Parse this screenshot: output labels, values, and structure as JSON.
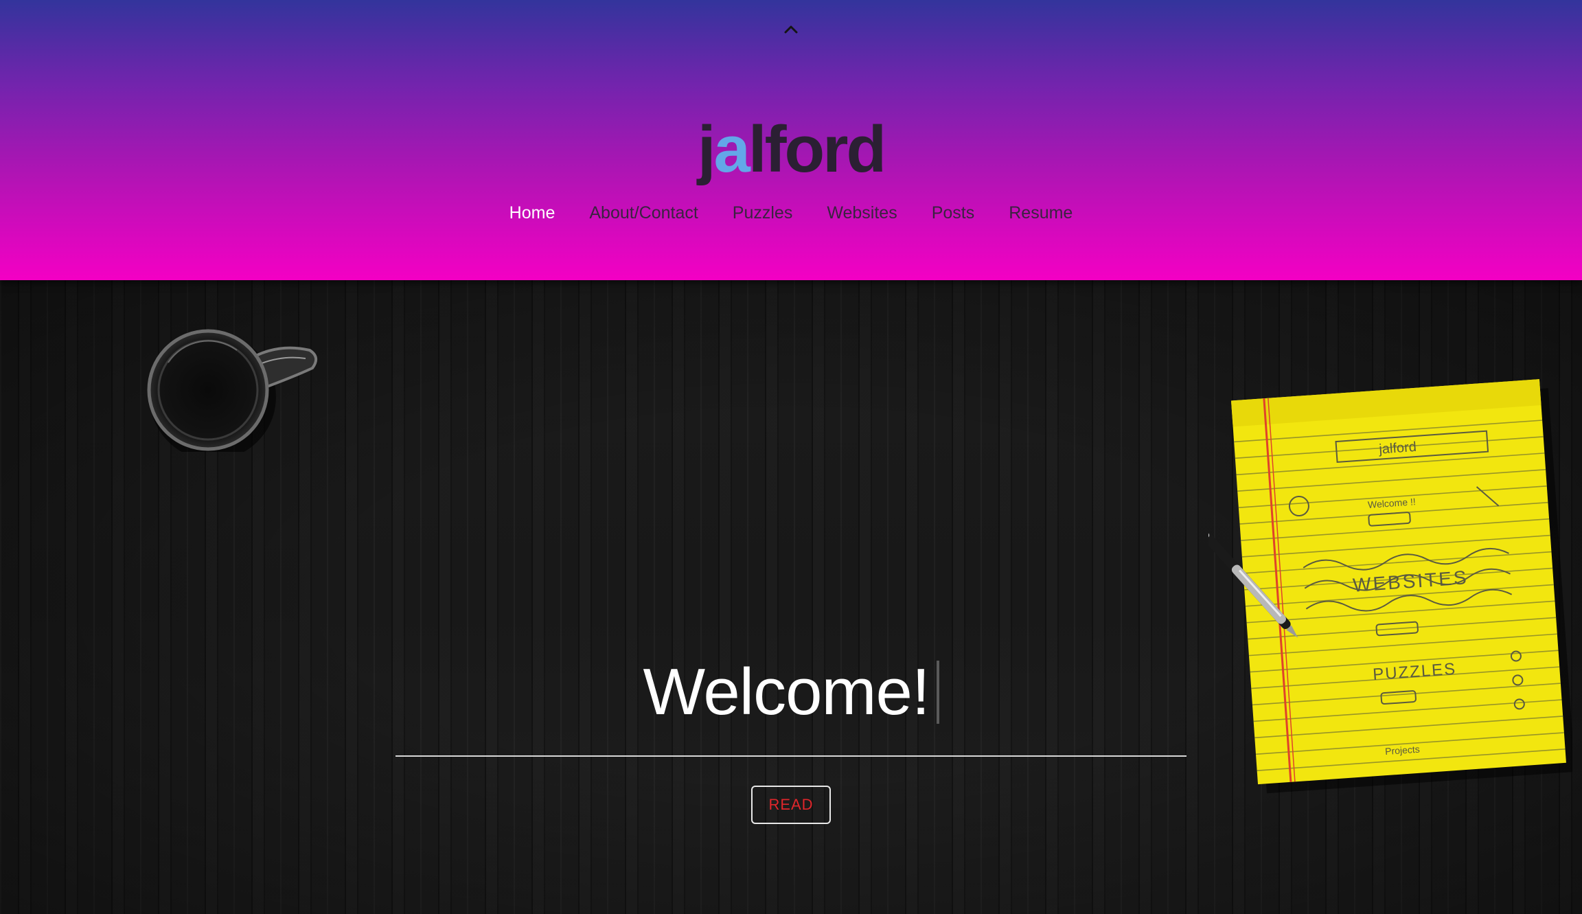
{
  "header": {
    "collapse_icon": "chevron-up-icon",
    "logo": {
      "prefix": "j",
      "accent": "a",
      "suffix": "lford"
    },
    "nav": [
      {
        "label": "Home",
        "active": true
      },
      {
        "label": "About/Contact",
        "active": false
      },
      {
        "label": "Puzzles",
        "active": false
      },
      {
        "label": "Websites",
        "active": false
      },
      {
        "label": "Posts",
        "active": false
      },
      {
        "label": "Resume",
        "active": false
      }
    ]
  },
  "hero": {
    "title": "Welcome!",
    "read_label": "READ"
  },
  "colors": {
    "header_top": "#33349c",
    "header_bottom": "#f400c4",
    "logo_text": "#2b1f33",
    "logo_accent": "#63a7e8",
    "nav_active": "#ffffff",
    "read_text": "#e0262b"
  }
}
